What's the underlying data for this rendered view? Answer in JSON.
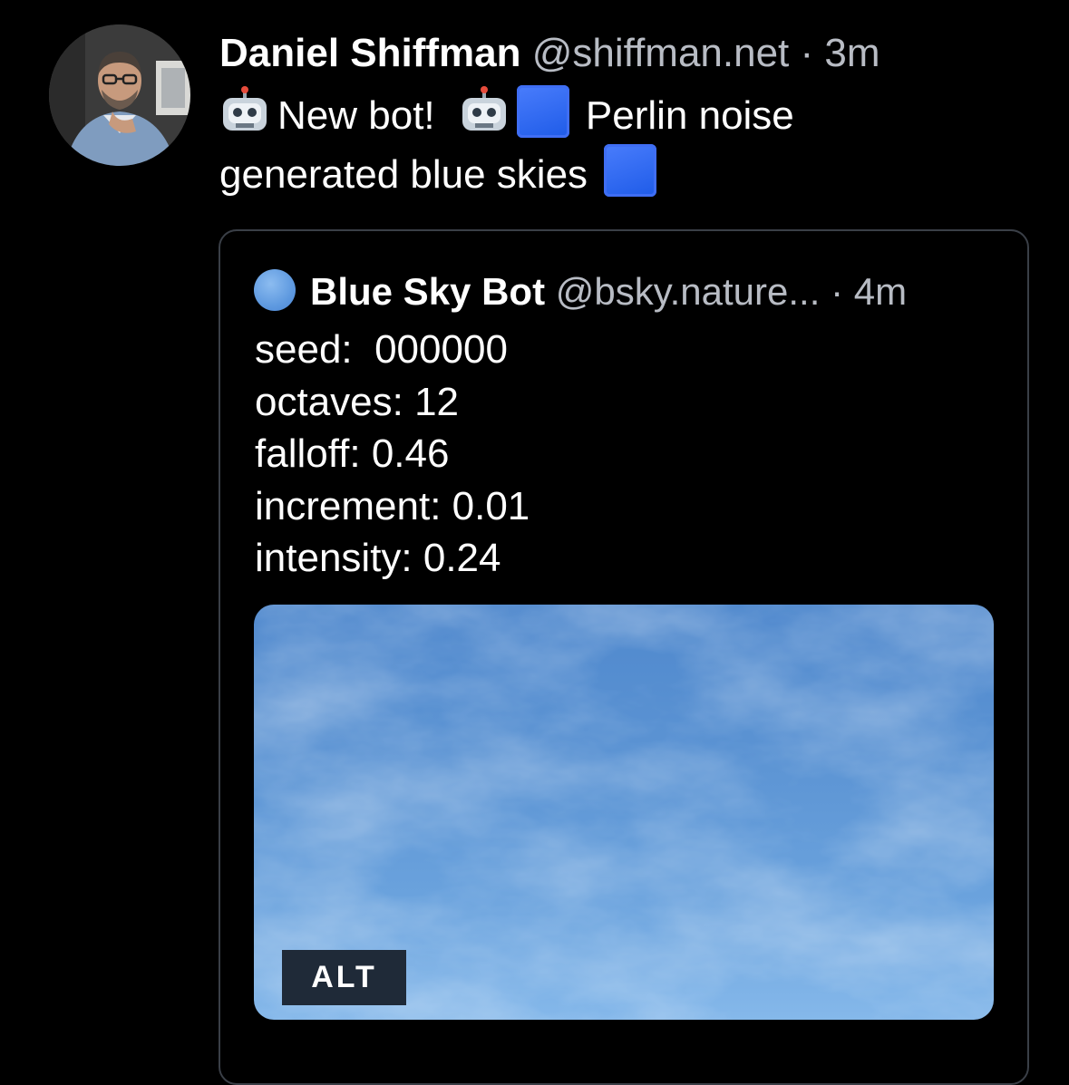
{
  "post": {
    "author_name": "Daniel Shiffman",
    "author_handle": "@shiffman.net",
    "separator": "·",
    "time": "3m",
    "text_part1": "New bot!",
    "text_part2": "Perlin noise",
    "text_part3": "generated blue skies",
    "emoji": [
      "robot-emoji",
      "blue-square-emoji"
    ]
  },
  "quote": {
    "author_name": "Blue Sky Bot",
    "author_handle": "@bsky.nature...",
    "separator": "·",
    "time": "4m",
    "params": [
      "seed:  000000",
      "octaves: 12",
      "falloff: 0.46",
      "increment: 0.01",
      "intensity: 0.24"
    ],
    "alt_label": "ALT"
  },
  "colors": {
    "background": "#000000",
    "text_primary": "#ffffff",
    "text_secondary": "#b8bcc4",
    "card_border": "#3a3f47",
    "sky_top": "#4f88cd",
    "sky_bottom": "#85b8ea",
    "alt_badge_bg": "#1f2a38",
    "blue_square": "#2c64f0"
  }
}
